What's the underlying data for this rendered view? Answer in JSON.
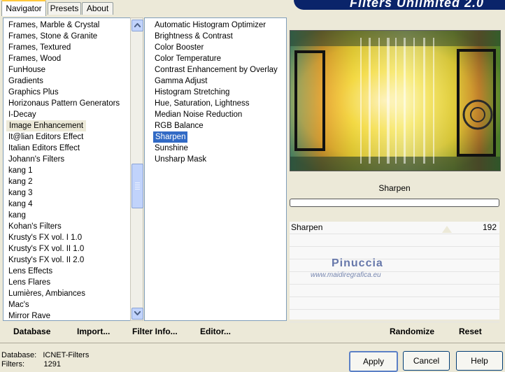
{
  "banner_title": "Filters Unlimited 2.0",
  "tabs": [
    {
      "label": "Navigator",
      "active": true
    },
    {
      "label": "Presets",
      "active": false
    },
    {
      "label": "About",
      "active": false
    }
  ],
  "categories": [
    "Frames, Marble & Crystal",
    "Frames, Stone & Granite",
    "Frames, Textured",
    "Frames, Wood",
    "FunHouse",
    "Gradients",
    "Graphics Plus",
    "Horizonaus Pattern Generators",
    "I-Decay",
    "Image Enhancement",
    "It@lian Editors Effect",
    "Italian Editors Effect",
    "Johann's Filters",
    "kang 1",
    "kang 2",
    "kang 3",
    "kang 4",
    "kang",
    "Kohan's Filters",
    "Krusty's FX vol. I 1.0",
    "Krusty's FX vol. II 1.0",
    "Krusty's FX vol. II 2.0",
    "Lens Effects",
    "Lens Flares",
    "Lumières, Ambiances",
    "Mac's",
    "Mirror Rave"
  ],
  "selected_category": "Image Enhancement",
  "filters": [
    "Automatic Histogram Optimizer",
    "Brightness & Contrast",
    "Color Booster",
    "Color Temperature",
    "Contrast Enhancement by Overlay",
    "Gamma Adjust",
    "Histogram Stretching",
    "Hue, Saturation, Lightness",
    "Median Noise Reduction",
    "RGB Balance",
    "Sharpen",
    "Sunshine",
    "Unsharp Mask"
  ],
  "selected_filter": "Sharpen",
  "preview_title": "Sharpen",
  "parameter": {
    "label": "Sharpen",
    "value": "192"
  },
  "watermark": {
    "name": "Pinuccia",
    "site": "www.maidiregrafica.eu"
  },
  "bottom_links": {
    "database": "Database",
    "import": "Import...",
    "filter_info": "Filter Info...",
    "editor": "Editor...",
    "randomize": "Randomize",
    "reset": "Reset"
  },
  "status": {
    "database_label": "Database:",
    "database_value": "ICNET-Filters",
    "filters_label": "Filters:",
    "filters_value": "1291"
  },
  "buttons": {
    "apply": "Apply",
    "cancel": "Cancel",
    "help": "Help"
  },
  "colors": {
    "selection": "#316ac5",
    "banner": "#0a246a"
  }
}
